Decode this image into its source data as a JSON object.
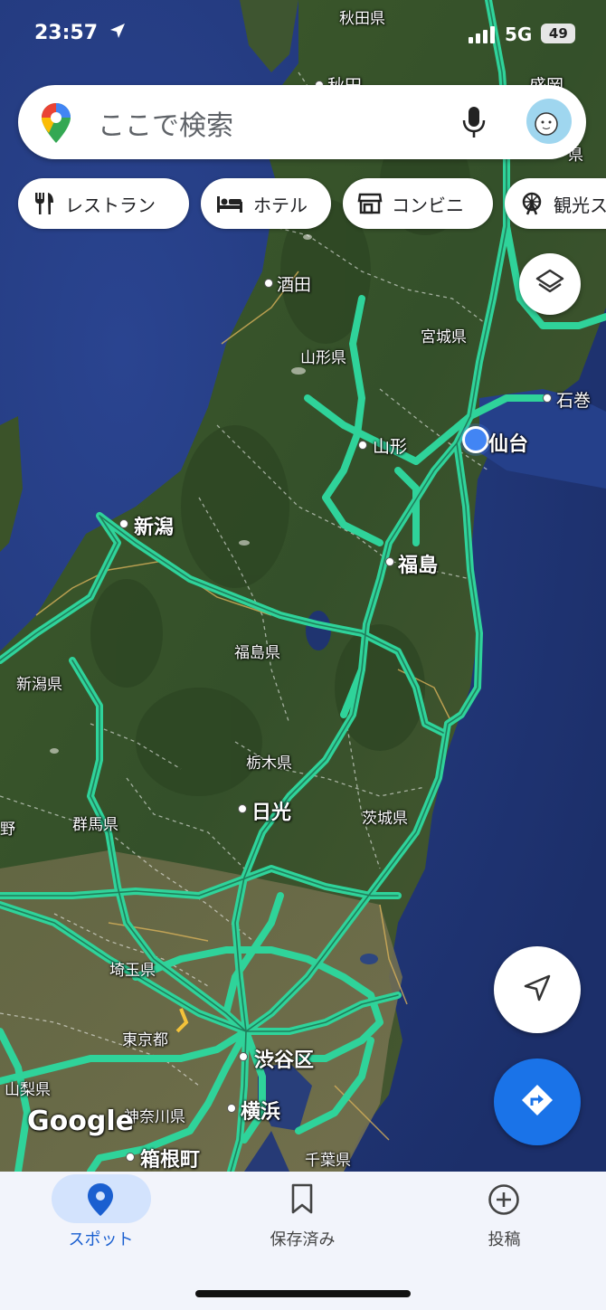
{
  "status_bar": {
    "time": "23:57",
    "network": "5G",
    "battery": "49"
  },
  "search": {
    "placeholder": "ここで検索"
  },
  "chips": [
    {
      "label": "レストラン",
      "icon": "fork-knife-icon"
    },
    {
      "label": "ホテル",
      "icon": "bed-icon"
    },
    {
      "label": "コンビニ",
      "icon": "store-icon"
    },
    {
      "label": "観光ス",
      "icon": "ferris-wheel-icon"
    }
  ],
  "map_labels": {
    "akita_pref": "秋田県",
    "akita": "秋田",
    "morioka_partial": "盛岡",
    "iwate_partial": "県",
    "sakata": "酒田",
    "miyagi_pref": "宮城県",
    "yamagata_pref": "山形県",
    "ishinomaki": "石巻",
    "yamagata": "山形",
    "sendai": "仙台",
    "niigata": "新潟",
    "fukushima": "福島",
    "fukushima_pref": "福島県",
    "niigata_pref": "新潟県",
    "tochigi_pref": "栃木県",
    "nikko": "日光",
    "gunma_pref": "群馬県",
    "ibaraki_pref": "茨城県",
    "nagano_partial": "野",
    "saitama_pref": "埼玉県",
    "tokyo": "東京都",
    "shibuya": "渋谷区",
    "yamanashi_pref": "山梨県",
    "kanagawa_pref": "神奈川県",
    "yokohama": "横浜",
    "hakone": "箱根町",
    "chiba_pref": "千葉県",
    "google_logo": "Google"
  },
  "nav": {
    "tabs": [
      {
        "label": "スポット",
        "icon": "location-pin-icon",
        "active": true
      },
      {
        "label": "保存済み",
        "icon": "bookmark-icon",
        "active": false
      },
      {
        "label": "投稿",
        "icon": "add-circle-icon",
        "active": false
      }
    ]
  },
  "colors": {
    "road": "#2fd39a",
    "accent": "#1a73e8",
    "location_dot": "#4285f4",
    "nav_bg": "#f2f4fb"
  }
}
